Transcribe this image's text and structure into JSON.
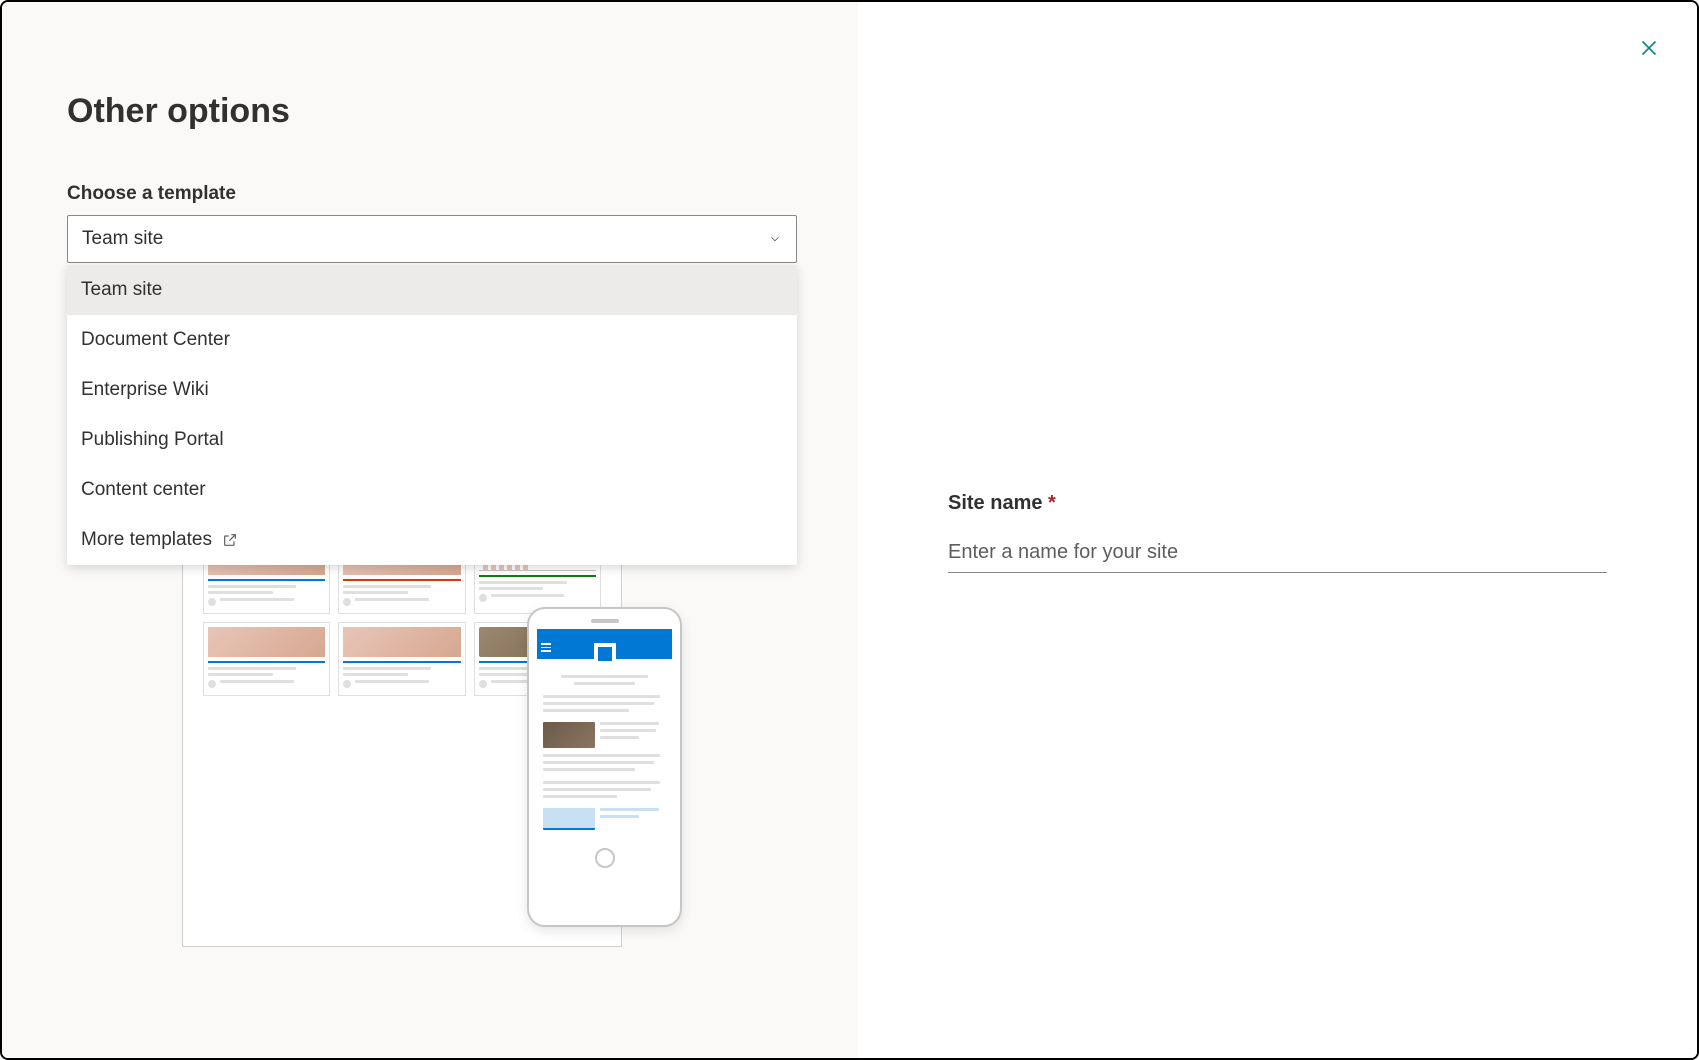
{
  "header": {
    "page_title": "Other options"
  },
  "template_field": {
    "label": "Choose a template",
    "selected": "Team site",
    "options": [
      "Team site",
      "Document Center",
      "Enterprise Wiki",
      "Publishing Portal",
      "Content center"
    ],
    "more_templates_label": "More templates"
  },
  "site_name": {
    "label": "Site name",
    "required_marker": "*",
    "placeholder": "Enter a name for your site"
  }
}
